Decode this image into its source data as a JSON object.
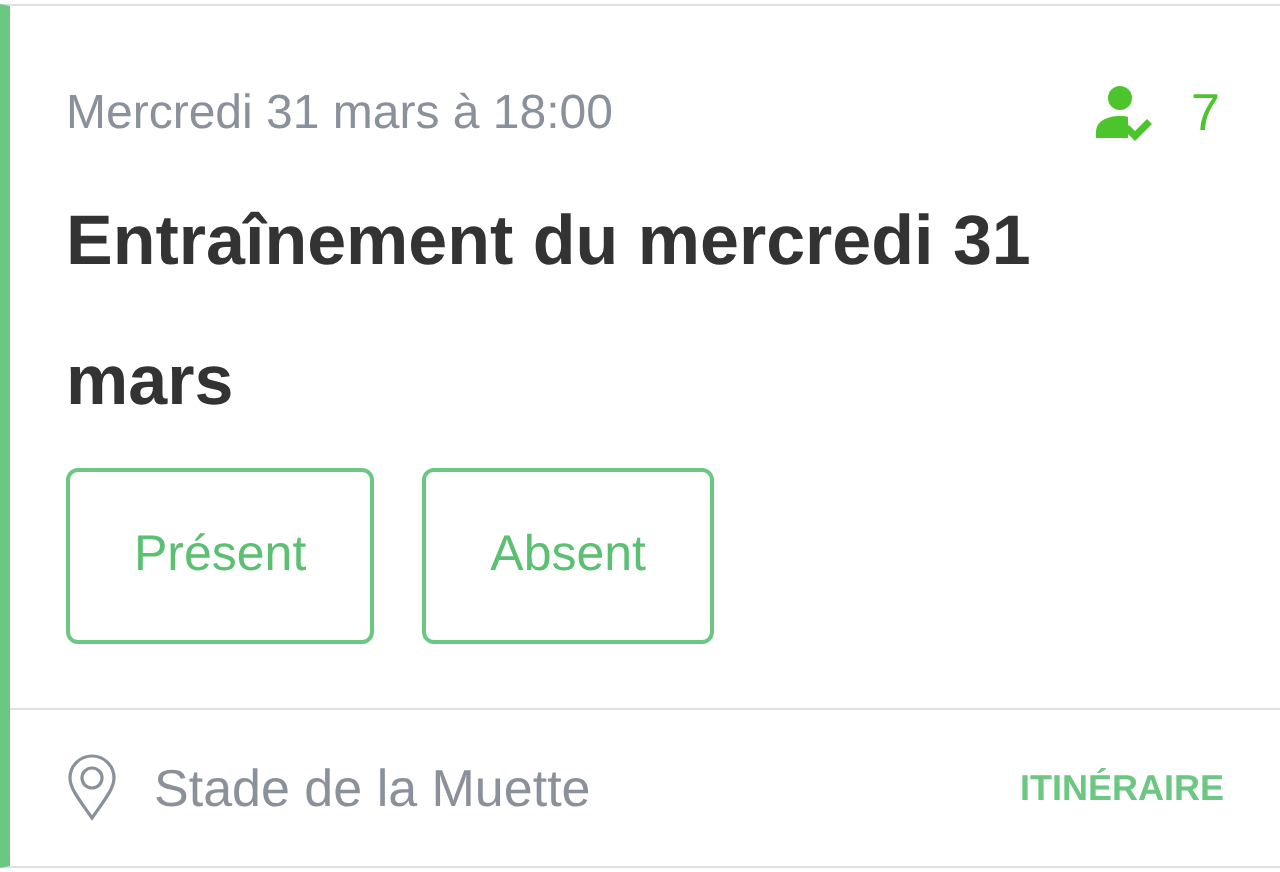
{
  "event": {
    "datetime": "Mercredi 31 mars à 18:00",
    "attendees": "7",
    "title": "Entraînement du mercredi 31 mars"
  },
  "responses": [
    {
      "label": "Présent",
      "selected": false
    },
    {
      "label": "Absent",
      "selected": false
    }
  ],
  "location": {
    "name": "Stade de la Muette",
    "action": "ITINÉRAIRE"
  }
}
